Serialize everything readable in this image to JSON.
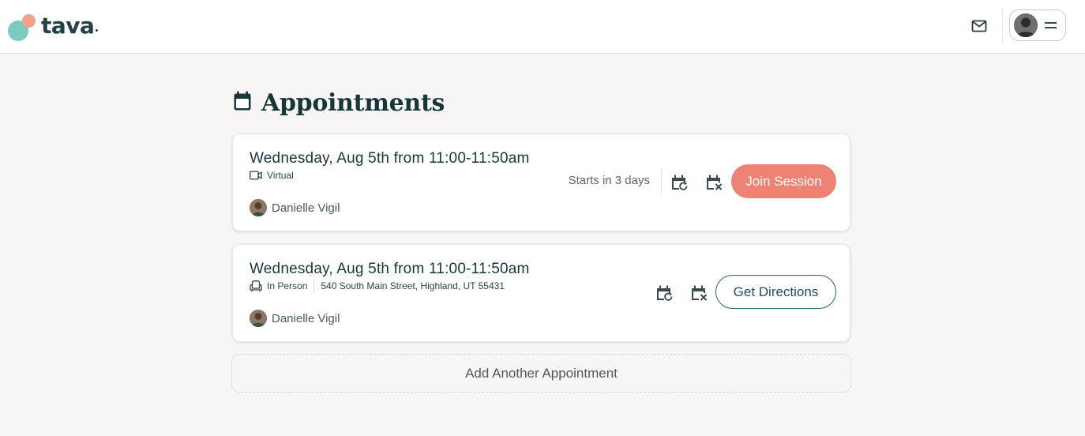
{
  "brand": {
    "name": "tava",
    "colors": {
      "teal": "#7ccbbf",
      "coral": "#f3a08f",
      "primary": "#ee8275",
      "outline": "#2c6478",
      "text": "#18363a"
    }
  },
  "header": {
    "mail_icon": "mail-icon",
    "profile_icon": "avatar-icon",
    "menu_icon": "hamburger-icon"
  },
  "page": {
    "title": "Appointments",
    "title_icon": "calendar-icon"
  },
  "appointments": [
    {
      "time": "Wednesday, Aug 5th from 11:00-11:50am",
      "type": "Virtual",
      "type_icon": "video-camera-icon",
      "provider": "Danielle Vigil",
      "starts_in": "Starts in 3 days",
      "reschedule_icon": "calendar-reschedule-icon",
      "cancel_icon": "calendar-cancel-icon",
      "action_label": "Join Session"
    },
    {
      "time": "Wednesday, Aug 5th from 11:00-11:50am",
      "type": "In Person",
      "type_icon": "chair-icon",
      "address": "540 South Main Street, Highland, UT 55431",
      "provider": "Danielle Vigil",
      "reschedule_icon": "calendar-reschedule-icon",
      "cancel_icon": "calendar-cancel-icon",
      "action_label": "Get Directions"
    }
  ],
  "add_appointment_label": "Add Another Appointment"
}
